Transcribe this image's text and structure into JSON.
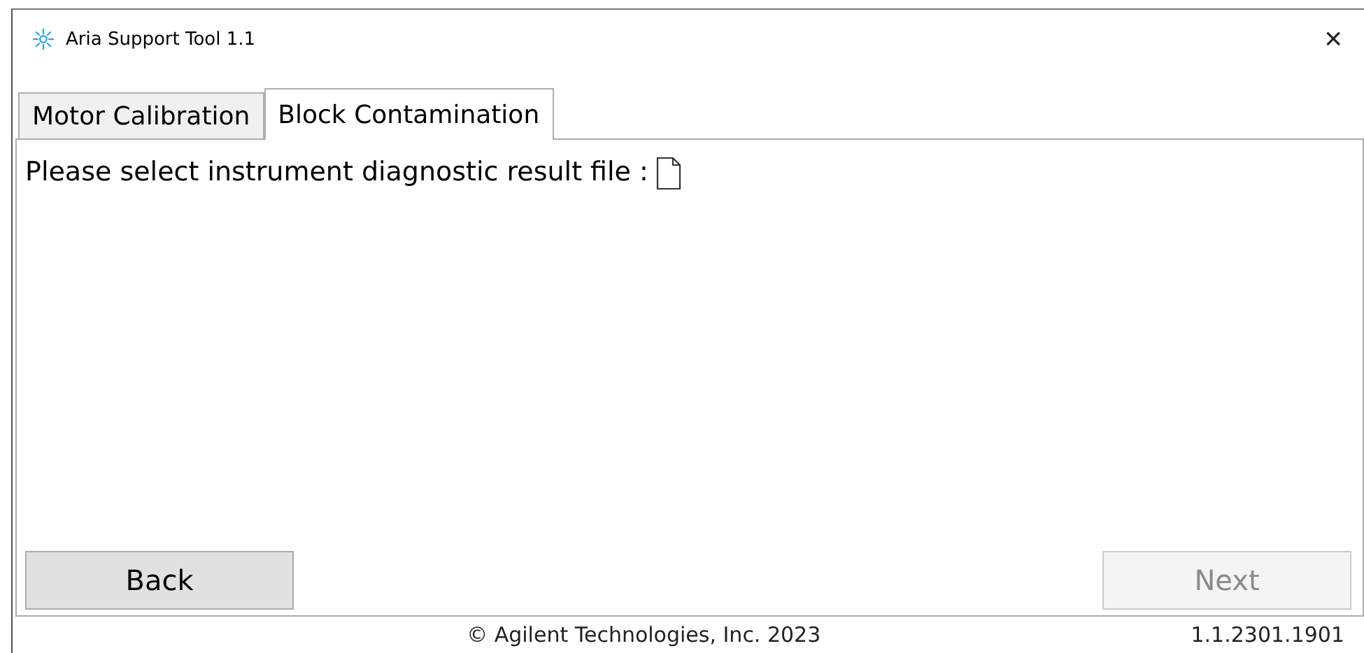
{
  "window": {
    "title": "Aria Support Tool 1.1",
    "close": "×"
  },
  "tabs": [
    {
      "label": "Motor Calibration",
      "selected": false
    },
    {
      "label": "Block Contamination",
      "selected": true
    }
  ],
  "prompt": "Please select instrument diagnostic result file :",
  "buttons": [
    {
      "label": "Back",
      "disabled": false
    },
    {
      "label": "Next",
      "disabled": true
    }
  ],
  "footer": {
    "copyright": "© Agilent Technologies, Inc. 2023",
    "version": "1.1.2301.1901"
  }
}
